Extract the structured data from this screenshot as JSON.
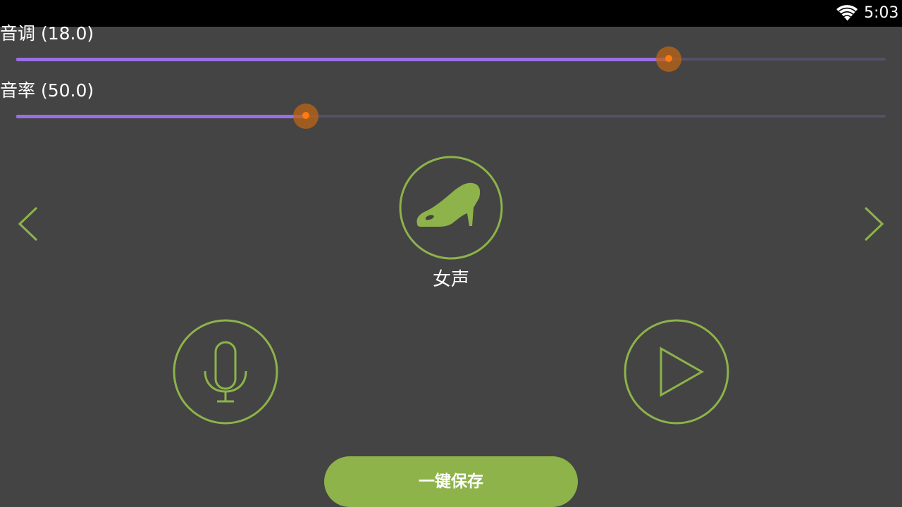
{
  "status_bar": {
    "time": "5:03",
    "wifi_icon": "wifi-icon"
  },
  "sliders": {
    "pitch": {
      "label": "音调 (18.0)",
      "fraction": 0.75
    },
    "rate": {
      "label": "音率 (50.0)",
      "fraction": 0.333
    }
  },
  "voice": {
    "label": "女声",
    "icon": "high-heel-icon"
  },
  "icons": {
    "prev": "chevron-left-icon",
    "next": "chevron-right-icon",
    "record": "microphone-icon",
    "play": "play-icon"
  },
  "save_button": {
    "label": "一键保存"
  },
  "colors": {
    "background": "#444444",
    "accent_green": "#8db34a",
    "slider_fill": "#9a6ee4",
    "slider_track": "#564f68",
    "thumb": "#ff7a12"
  }
}
